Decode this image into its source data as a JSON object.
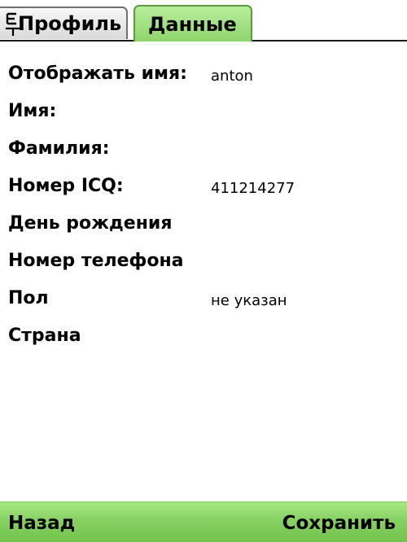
{
  "tabs": {
    "profile_label": "Профиль",
    "data_label": "Данные",
    "active": "data",
    "active_color": "#9edc7c"
  },
  "fields": {
    "display_name": {
      "label": "Отображать имя:",
      "value": "anton"
    },
    "first_name": {
      "label": "Имя:",
      "value": ""
    },
    "last_name": {
      "label": "Фамилия:",
      "value": ""
    },
    "icq_number": {
      "label": "Номер ICQ:",
      "value": "411214277"
    },
    "birthday": {
      "label": "День рождения",
      "value": ""
    },
    "phone_number": {
      "label": "Номер телефона",
      "value": ""
    },
    "gender": {
      "label": "Пол",
      "value": "не указан"
    },
    "country": {
      "label": "Страна",
      "value": ""
    }
  },
  "softkeys": {
    "left_label": "Назад",
    "right_label": "Сохранить",
    "bar_color": "#86d062"
  },
  "icons": {
    "tab_icon": "e-underline-icon"
  }
}
